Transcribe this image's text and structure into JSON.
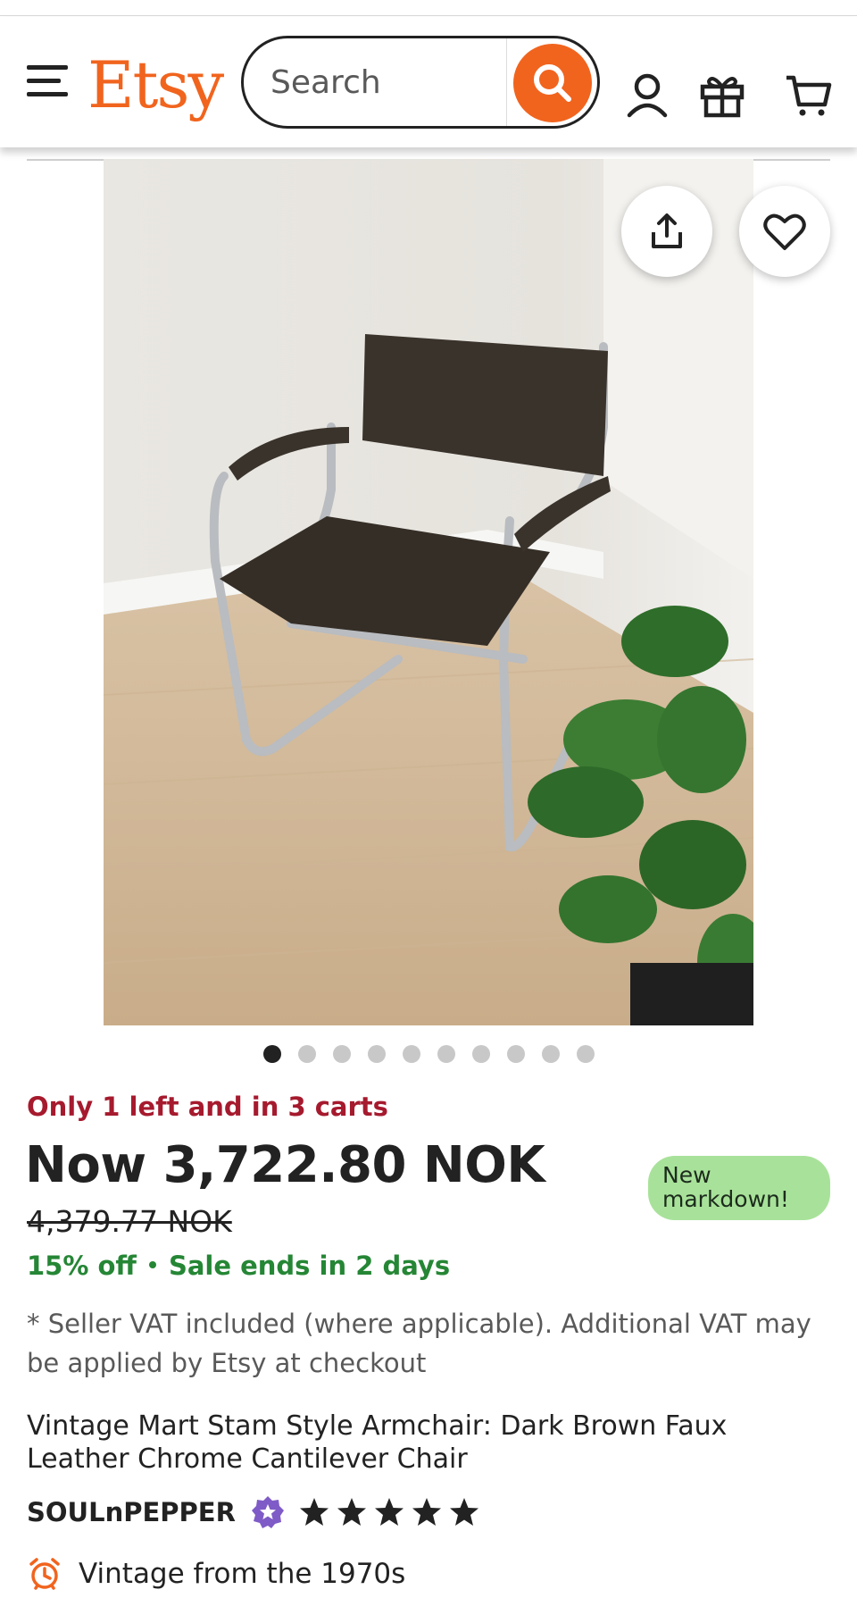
{
  "header": {
    "logo": "Etsy",
    "search_placeholder": "Search",
    "icons": [
      "menu-icon",
      "search-icon",
      "account-icon",
      "gift-icon",
      "cart-icon"
    ]
  },
  "gallery": {
    "image_count": 10,
    "active_index": 0,
    "actions": [
      "share-icon",
      "favorite-heart-icon"
    ]
  },
  "listing": {
    "stock_note": "Only 1 left and in 3 carts",
    "price": "Now 3,722.80 NOK",
    "original_price": "4,379.77 NOK",
    "markdown_badge": "New markdown!",
    "discount": "15% off",
    "sale_end": "Sale ends in 2 days",
    "vat_note": "* Seller VAT included (where applicable). Additional VAT may be applied by Etsy at checkout",
    "title": "Vintage Mart Stam Style Armchair: Dark Brown Faux Leather Chrome Cantilever Chair",
    "seller": "SOULnPEPPER",
    "rating": 5,
    "rating_max": 5,
    "vintage_note": "Vintage from the 1970s"
  },
  "colors": {
    "brand": "#f1641e",
    "stock_red": "#a61a2e",
    "sale_green": "#258635",
    "badge_green": "#a8e29a",
    "star_seller_purple": "#7f5bc7"
  }
}
